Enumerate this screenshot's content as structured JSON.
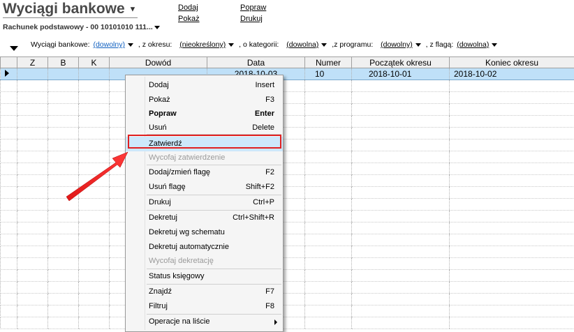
{
  "header": {
    "title": "Wyciągi bankowe",
    "account": "Rachunek podstawowy - 00 10101010 111...",
    "links_col1": [
      "Dodaj",
      "Pokaż"
    ],
    "links_col2": [
      "Popraw",
      "Drukuj"
    ]
  },
  "filters": {
    "label_statements": "Wyciągi bankowe:",
    "statements_value": "(dowolny)",
    "label_period": ", z okresu:",
    "period_value": "(nieokreślony)",
    "label_category": ", o kategorii:",
    "category_value": "(dowolna)",
    "label_program": ",z programu:",
    "program_value": "(dowolny)",
    "label_flag": ", z flagą:",
    "flag_value": "(dowolna)"
  },
  "table": {
    "columns": [
      "Z",
      "B",
      "K",
      "Dowód",
      "Data",
      "Numer",
      "Początek okresu",
      "Koniec okresu"
    ],
    "selected_row": {
      "z": "",
      "b": "",
      "k": "",
      "dowod": "",
      "data": "2018-10-03",
      "numer": "10",
      "poczatek": "2018-10-01",
      "koniec": "2018-10-02"
    }
  },
  "menu": {
    "items": [
      {
        "label": "Dodaj",
        "shortcut": "Insert"
      },
      {
        "label": "Pokaż",
        "shortcut": "F3"
      },
      {
        "label": "Popraw",
        "shortcut": "Enter"
      },
      {
        "label": "Usuń",
        "shortcut": "Delete"
      },
      {
        "label": "Zatwierdź",
        "shortcut": ""
      },
      {
        "label": "Wycofaj zatwierdzenie",
        "shortcut": ""
      },
      {
        "label": "Dodaj/zmień flagę",
        "shortcut": "F2"
      },
      {
        "label": "Usuń flagę",
        "shortcut": "Shift+F2"
      },
      {
        "label": "Drukuj",
        "shortcut": "Ctrl+P"
      },
      {
        "label": "Dekretuj",
        "shortcut": "Ctrl+Shift+R"
      },
      {
        "label": "Dekretuj wg schematu",
        "shortcut": ""
      },
      {
        "label": "Dekretuj automatycznie",
        "shortcut": ""
      },
      {
        "label": "Wycofaj dekretację",
        "shortcut": ""
      },
      {
        "label": "Status księgowy",
        "shortcut": ""
      },
      {
        "label": "Znajdź",
        "shortcut": "F7"
      },
      {
        "label": "Filtruj",
        "shortcut": "F8"
      },
      {
        "label": "Operacje na liście",
        "shortcut": ""
      }
    ]
  },
  "colors": {
    "highlight_box": "#e02020",
    "selected_row": "#bfe0f8",
    "arrow": "#e02020"
  }
}
